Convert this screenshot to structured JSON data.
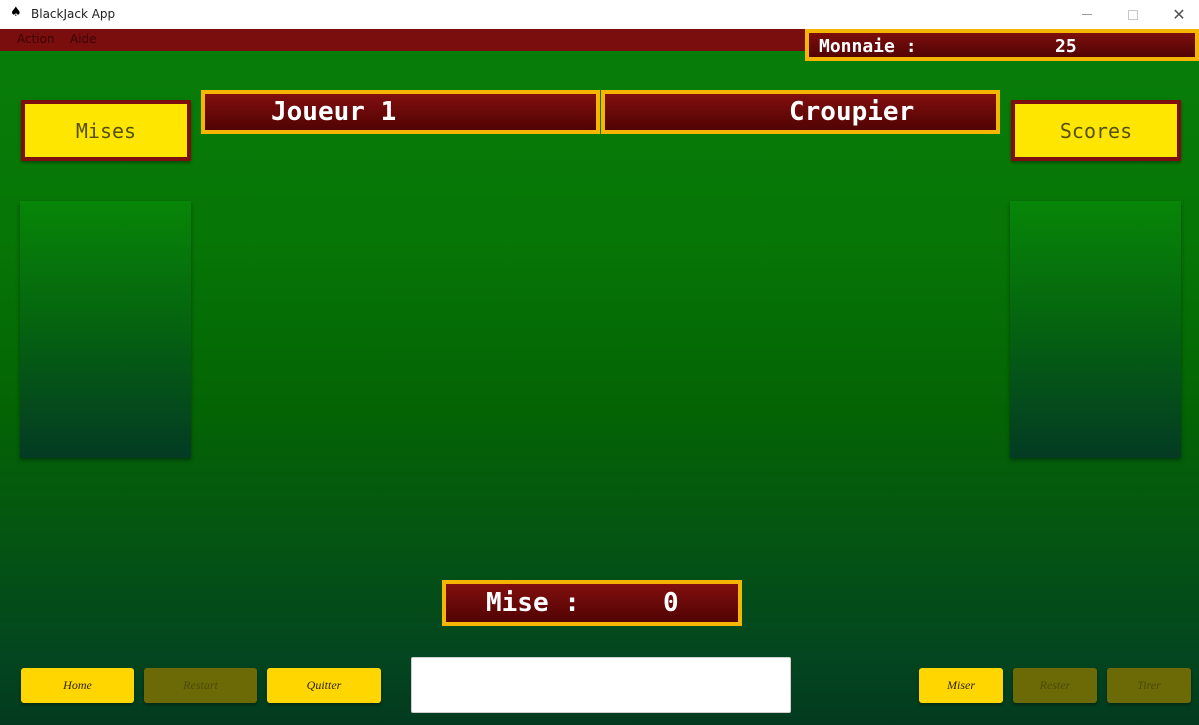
{
  "window": {
    "title": "BlackJack App",
    "icon": "spade-icon",
    "controls": {
      "minimize": "minimize",
      "maximize": "maximize",
      "close": "✕"
    }
  },
  "menu": {
    "items": [
      {
        "label": "Action"
      },
      {
        "label": "Aide"
      }
    ]
  },
  "money": {
    "label": "Monnaie :",
    "value": "25"
  },
  "buttons_top": {
    "mises": "Mises",
    "scores": "Scores"
  },
  "banners": {
    "player": "Joueur 1",
    "dealer": "Croupier"
  },
  "bet": {
    "label": "Mise :",
    "value": "0"
  },
  "actions_left": [
    {
      "label": "Home",
      "enabled": true
    },
    {
      "label": "Restart",
      "enabled": false
    },
    {
      "label": "Quitter",
      "enabled": true
    }
  ],
  "actions_right": [
    {
      "label": "Miser",
      "enabled": true
    },
    {
      "label": "Rester",
      "enabled": false
    },
    {
      "label": "Tirer",
      "enabled": false
    }
  ],
  "message_box": {
    "value": ""
  },
  "colors": {
    "felt": "#067606",
    "banner_red": "#7d0e0e",
    "gold_border": "#f5b500",
    "button_yellow": "#ffd600"
  }
}
